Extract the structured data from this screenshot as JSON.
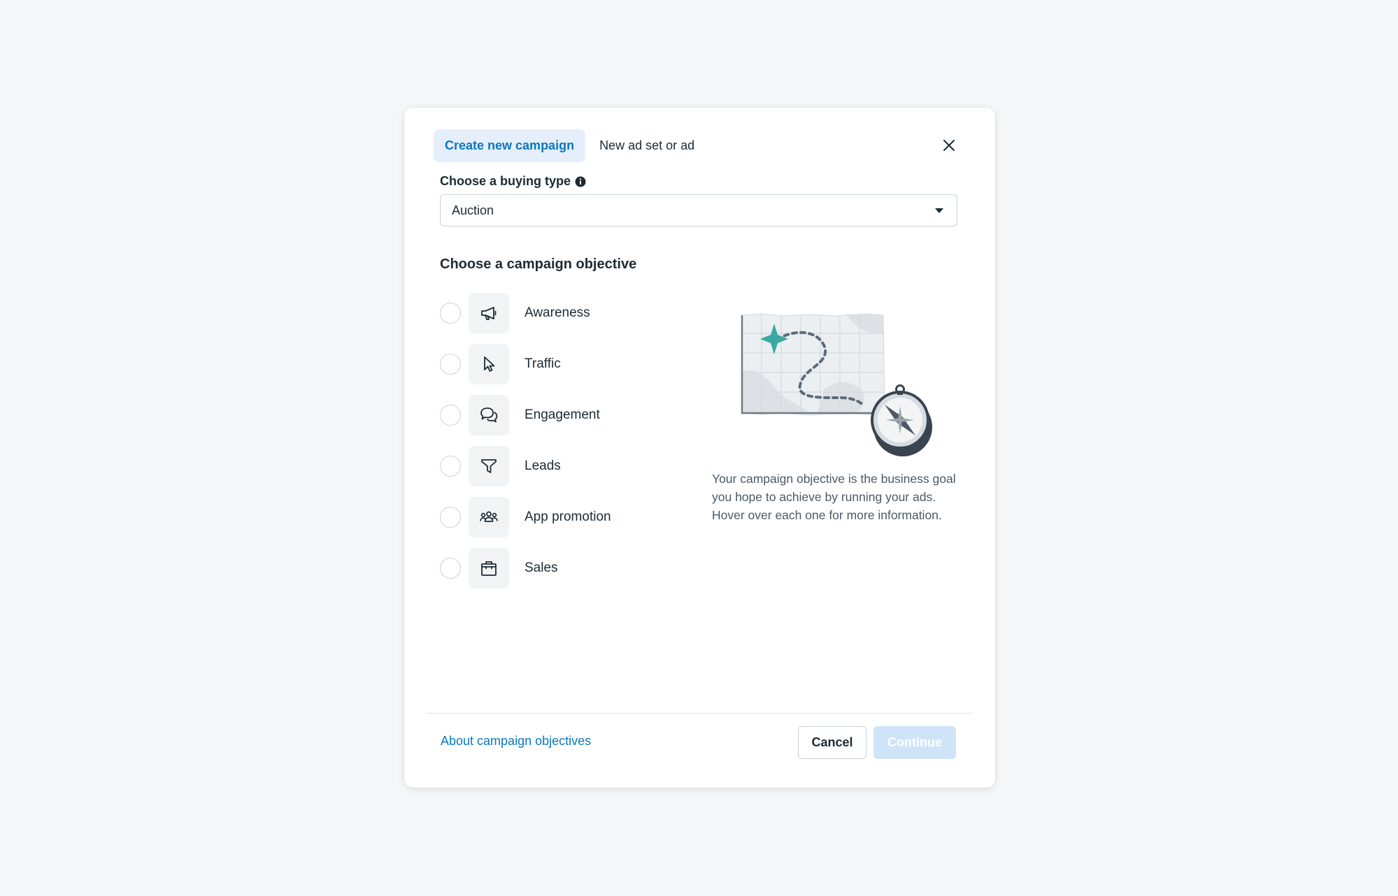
{
  "tabs": [
    {
      "label": "Create new campaign",
      "active": true
    },
    {
      "label": "New ad set or ad",
      "active": false
    }
  ],
  "buying_type": {
    "label": "Choose a buying type",
    "selected": "Auction"
  },
  "objective": {
    "heading": "Choose a campaign objective",
    "items": [
      {
        "label": "Awareness",
        "icon": "megaphone-icon"
      },
      {
        "label": "Traffic",
        "icon": "cursor-icon"
      },
      {
        "label": "Engagement",
        "icon": "chat-bubbles-icon"
      },
      {
        "label": "Leads",
        "icon": "funnel-icon"
      },
      {
        "label": "App promotion",
        "icon": "people-group-icon"
      },
      {
        "label": "Sales",
        "icon": "shopping-bag-icon"
      }
    ],
    "description": "Your campaign objective is the business goal you hope to achieve by running your ads. Hover over each one for more information."
  },
  "footer": {
    "about_link": "About campaign objectives",
    "cancel_label": "Cancel",
    "continue_label": "Continue"
  },
  "colors": {
    "accent": "#0a78be",
    "active_tab_bg": "#e5eefa",
    "continue_disabled_bg": "#cfe4f8",
    "map_teal": "#3aa9a3"
  }
}
